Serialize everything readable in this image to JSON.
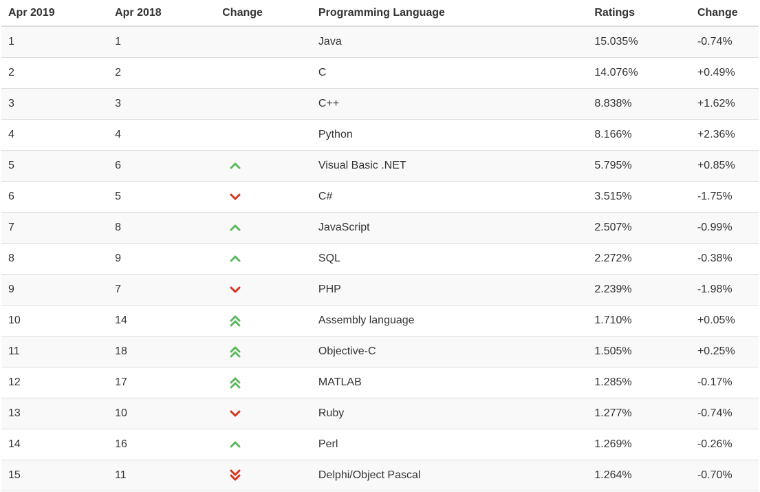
{
  "table": {
    "headers": [
      "Apr 2019",
      "Apr 2018",
      "Change",
      "Programming Language",
      "Ratings",
      "Change"
    ],
    "rows": [
      {
        "rank_2019": "1",
        "rank_2018": "1",
        "trend": "none",
        "language": "Java",
        "rating": "15.035%",
        "change": "-0.74%"
      },
      {
        "rank_2019": "2",
        "rank_2018": "2",
        "trend": "none",
        "language": "C",
        "rating": "14.076%",
        "change": "+0.49%"
      },
      {
        "rank_2019": "3",
        "rank_2018": "3",
        "trend": "none",
        "language": "C++",
        "rating": "8.838%",
        "change": "+1.62%"
      },
      {
        "rank_2019": "4",
        "rank_2018": "4",
        "trend": "none",
        "language": "Python",
        "rating": "8.166%",
        "change": "+2.36%"
      },
      {
        "rank_2019": "5",
        "rank_2018": "6",
        "trend": "up",
        "language": "Visual Basic .NET",
        "rating": "5.795%",
        "change": "+0.85%"
      },
      {
        "rank_2019": "6",
        "rank_2018": "5",
        "trend": "down",
        "language": "C#",
        "rating": "3.515%",
        "change": "-1.75%"
      },
      {
        "rank_2019": "7",
        "rank_2018": "8",
        "trend": "up",
        "language": "JavaScript",
        "rating": "2.507%",
        "change": "-0.99%"
      },
      {
        "rank_2019": "8",
        "rank_2018": "9",
        "trend": "up",
        "language": "SQL",
        "rating": "2.272%",
        "change": "-0.38%"
      },
      {
        "rank_2019": "9",
        "rank_2018": "7",
        "trend": "down",
        "language": "PHP",
        "rating": "2.239%",
        "change": "-1.98%"
      },
      {
        "rank_2019": "10",
        "rank_2018": "14",
        "trend": "double-up",
        "language": "Assembly language",
        "rating": "1.710%",
        "change": "+0.05%"
      },
      {
        "rank_2019": "11",
        "rank_2018": "18",
        "trend": "double-up",
        "language": "Objective-C",
        "rating": "1.505%",
        "change": "+0.25%"
      },
      {
        "rank_2019": "12",
        "rank_2018": "17",
        "trend": "double-up",
        "language": "MATLAB",
        "rating": "1.285%",
        "change": "-0.17%"
      },
      {
        "rank_2019": "13",
        "rank_2018": "10",
        "trend": "down",
        "language": "Ruby",
        "rating": "1.277%",
        "change": "-0.74%"
      },
      {
        "rank_2019": "14",
        "rank_2018": "16",
        "trend": "up",
        "language": "Perl",
        "rating": "1.269%",
        "change": "-0.26%"
      },
      {
        "rank_2019": "15",
        "rank_2018": "11",
        "trend": "double-down",
        "language": "Delphi/Object Pascal",
        "rating": "1.264%",
        "change": "-0.70%"
      }
    ]
  },
  "icons": {
    "up": "chevron-up-icon",
    "down": "chevron-down-icon",
    "double-up": "double-chevron-up-icon",
    "double-down": "double-chevron-down-icon"
  },
  "colors": {
    "up": "#5cb85c",
    "down": "#d9341c",
    "text": "#333333",
    "stripe": "#f9f9f9",
    "border": "#dddddd"
  }
}
